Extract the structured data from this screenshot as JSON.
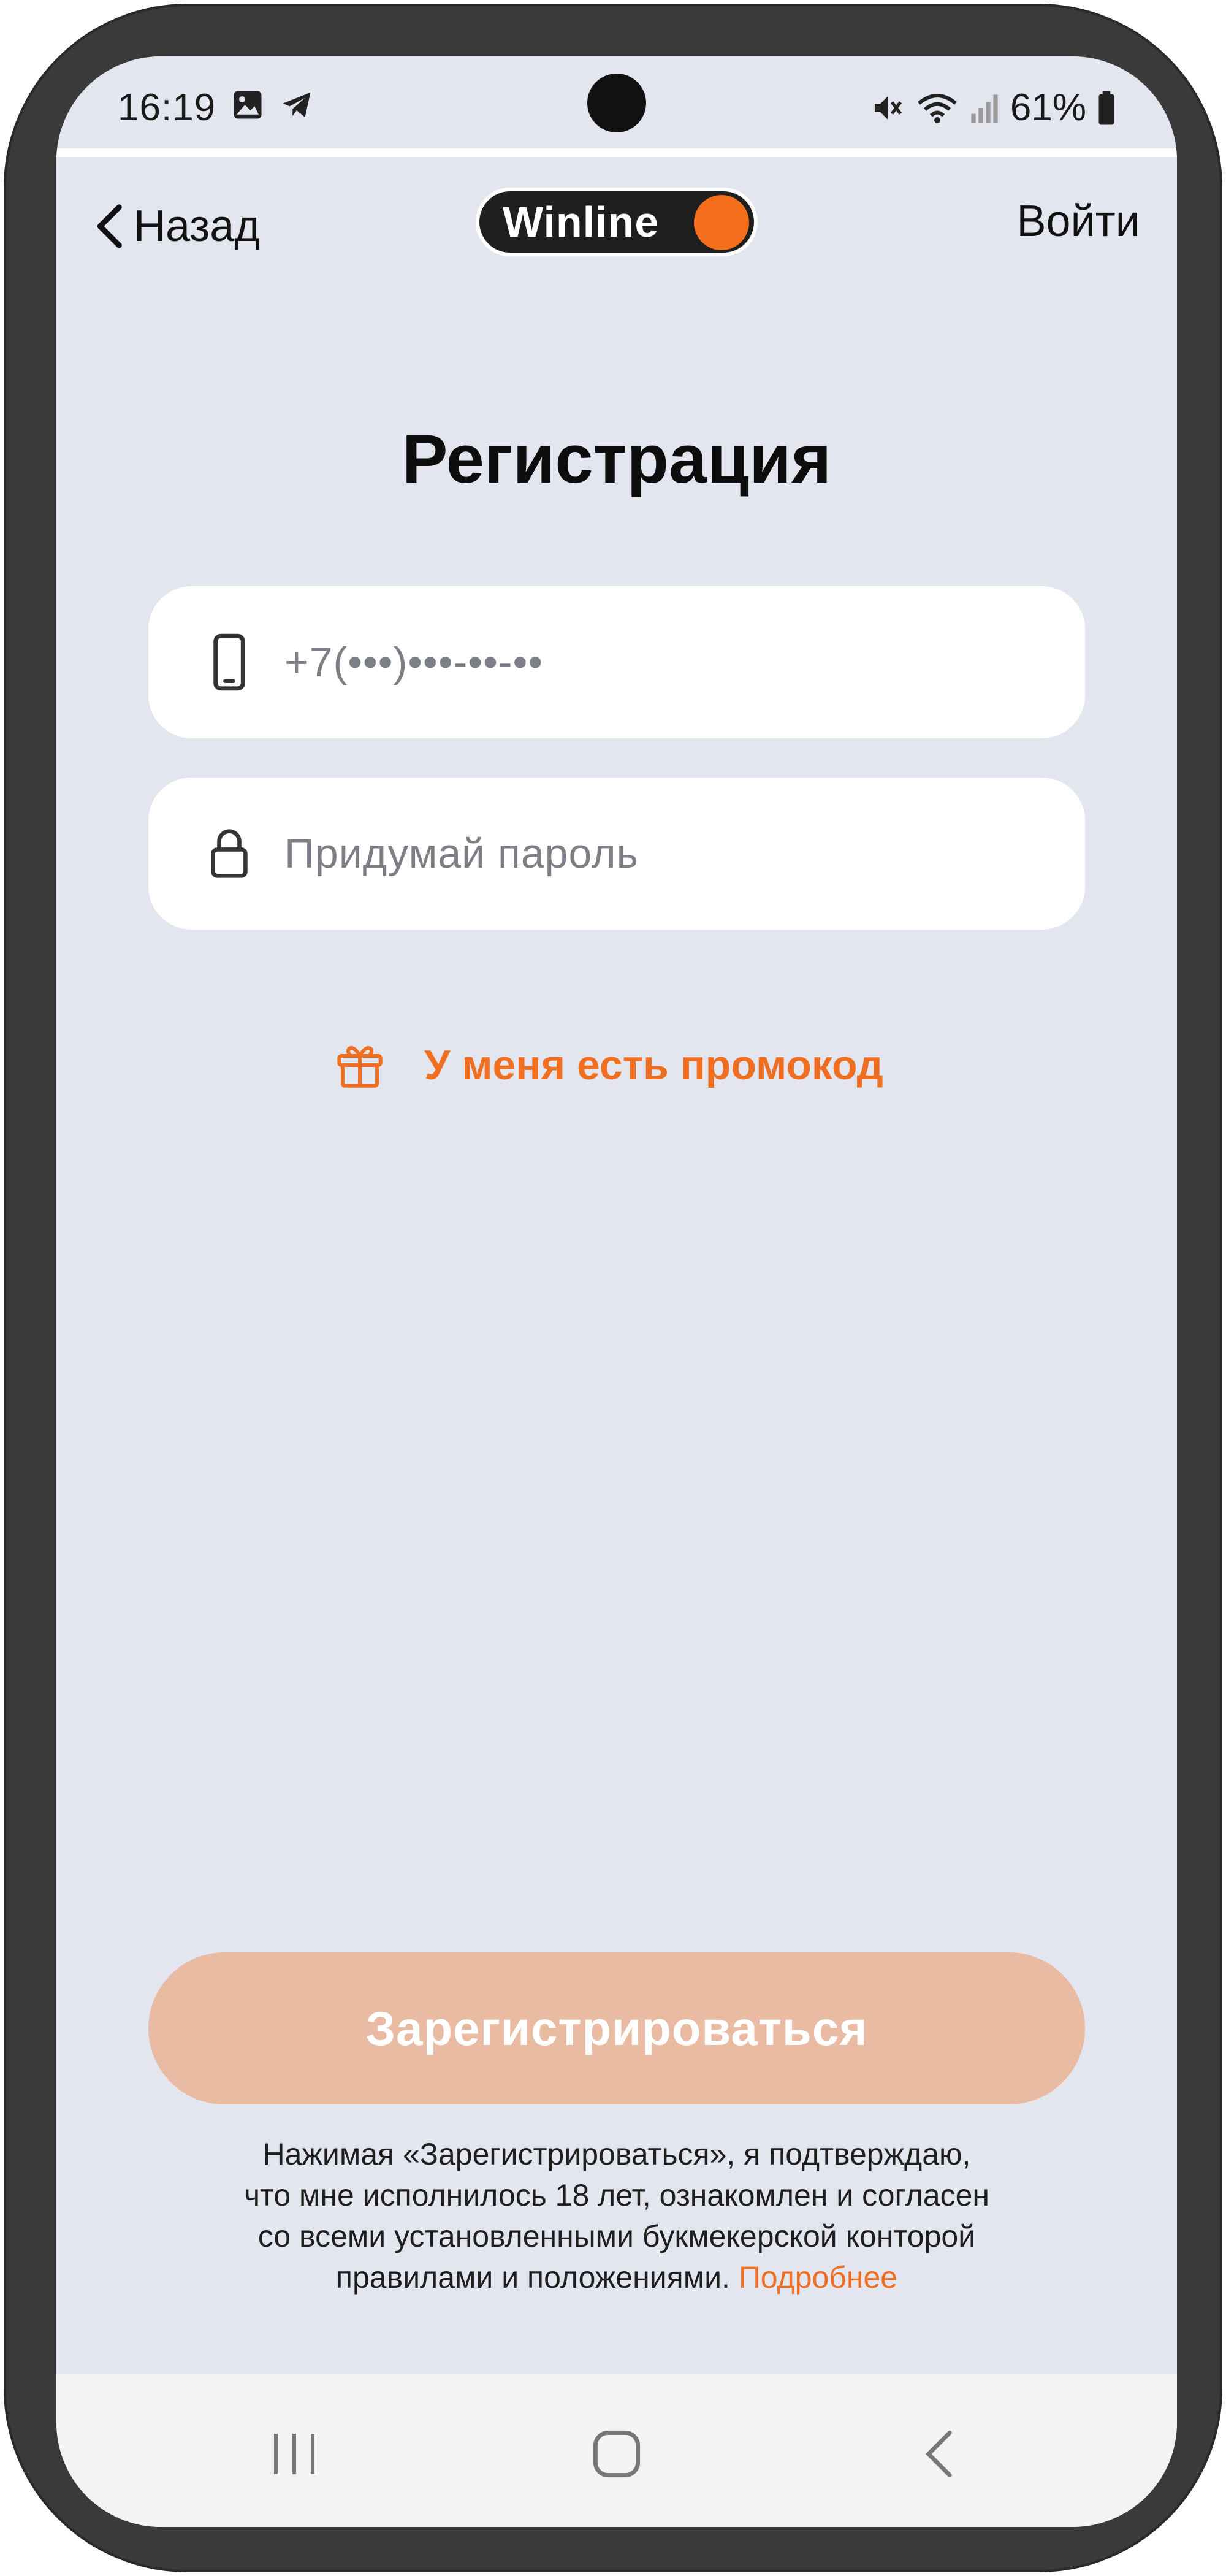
{
  "status_bar": {
    "time": "16:19",
    "battery": "61%",
    "icons_left": [
      "gallery-icon",
      "telegram-icon"
    ],
    "icons_right": [
      "mute-icon",
      "wifi-icon",
      "signal-icon",
      "battery-icon"
    ]
  },
  "header": {
    "back_label": "Назад",
    "logo_text": "Winline",
    "login_label": "Войти"
  },
  "page": {
    "title": "Регистрация"
  },
  "form": {
    "phone_placeholder": "+7(•••)•••-••-••",
    "password_placeholder": "Придумай пароль",
    "promo_label": "У меня есть промокод",
    "submit_label": "Зарегистрироваться"
  },
  "disclaimer": {
    "line1": "Нажимая «Зарегистрироваться», я подтверждаю,",
    "line2": "что мне исполнилось 18 лет, ознакомлен и согласен",
    "line3": "со всеми установленными букмекерской конторой",
    "line4": "правилами и положениями.",
    "more_link": "Подробнее"
  },
  "colors": {
    "accent": "#ee6e22",
    "logo_dot": "#f36f1c",
    "button_disabled": "#e9bba3",
    "background": "#e3e6ee"
  },
  "nav": {
    "icons": [
      "recent-apps-icon",
      "home-icon",
      "back-nav-icon"
    ]
  }
}
